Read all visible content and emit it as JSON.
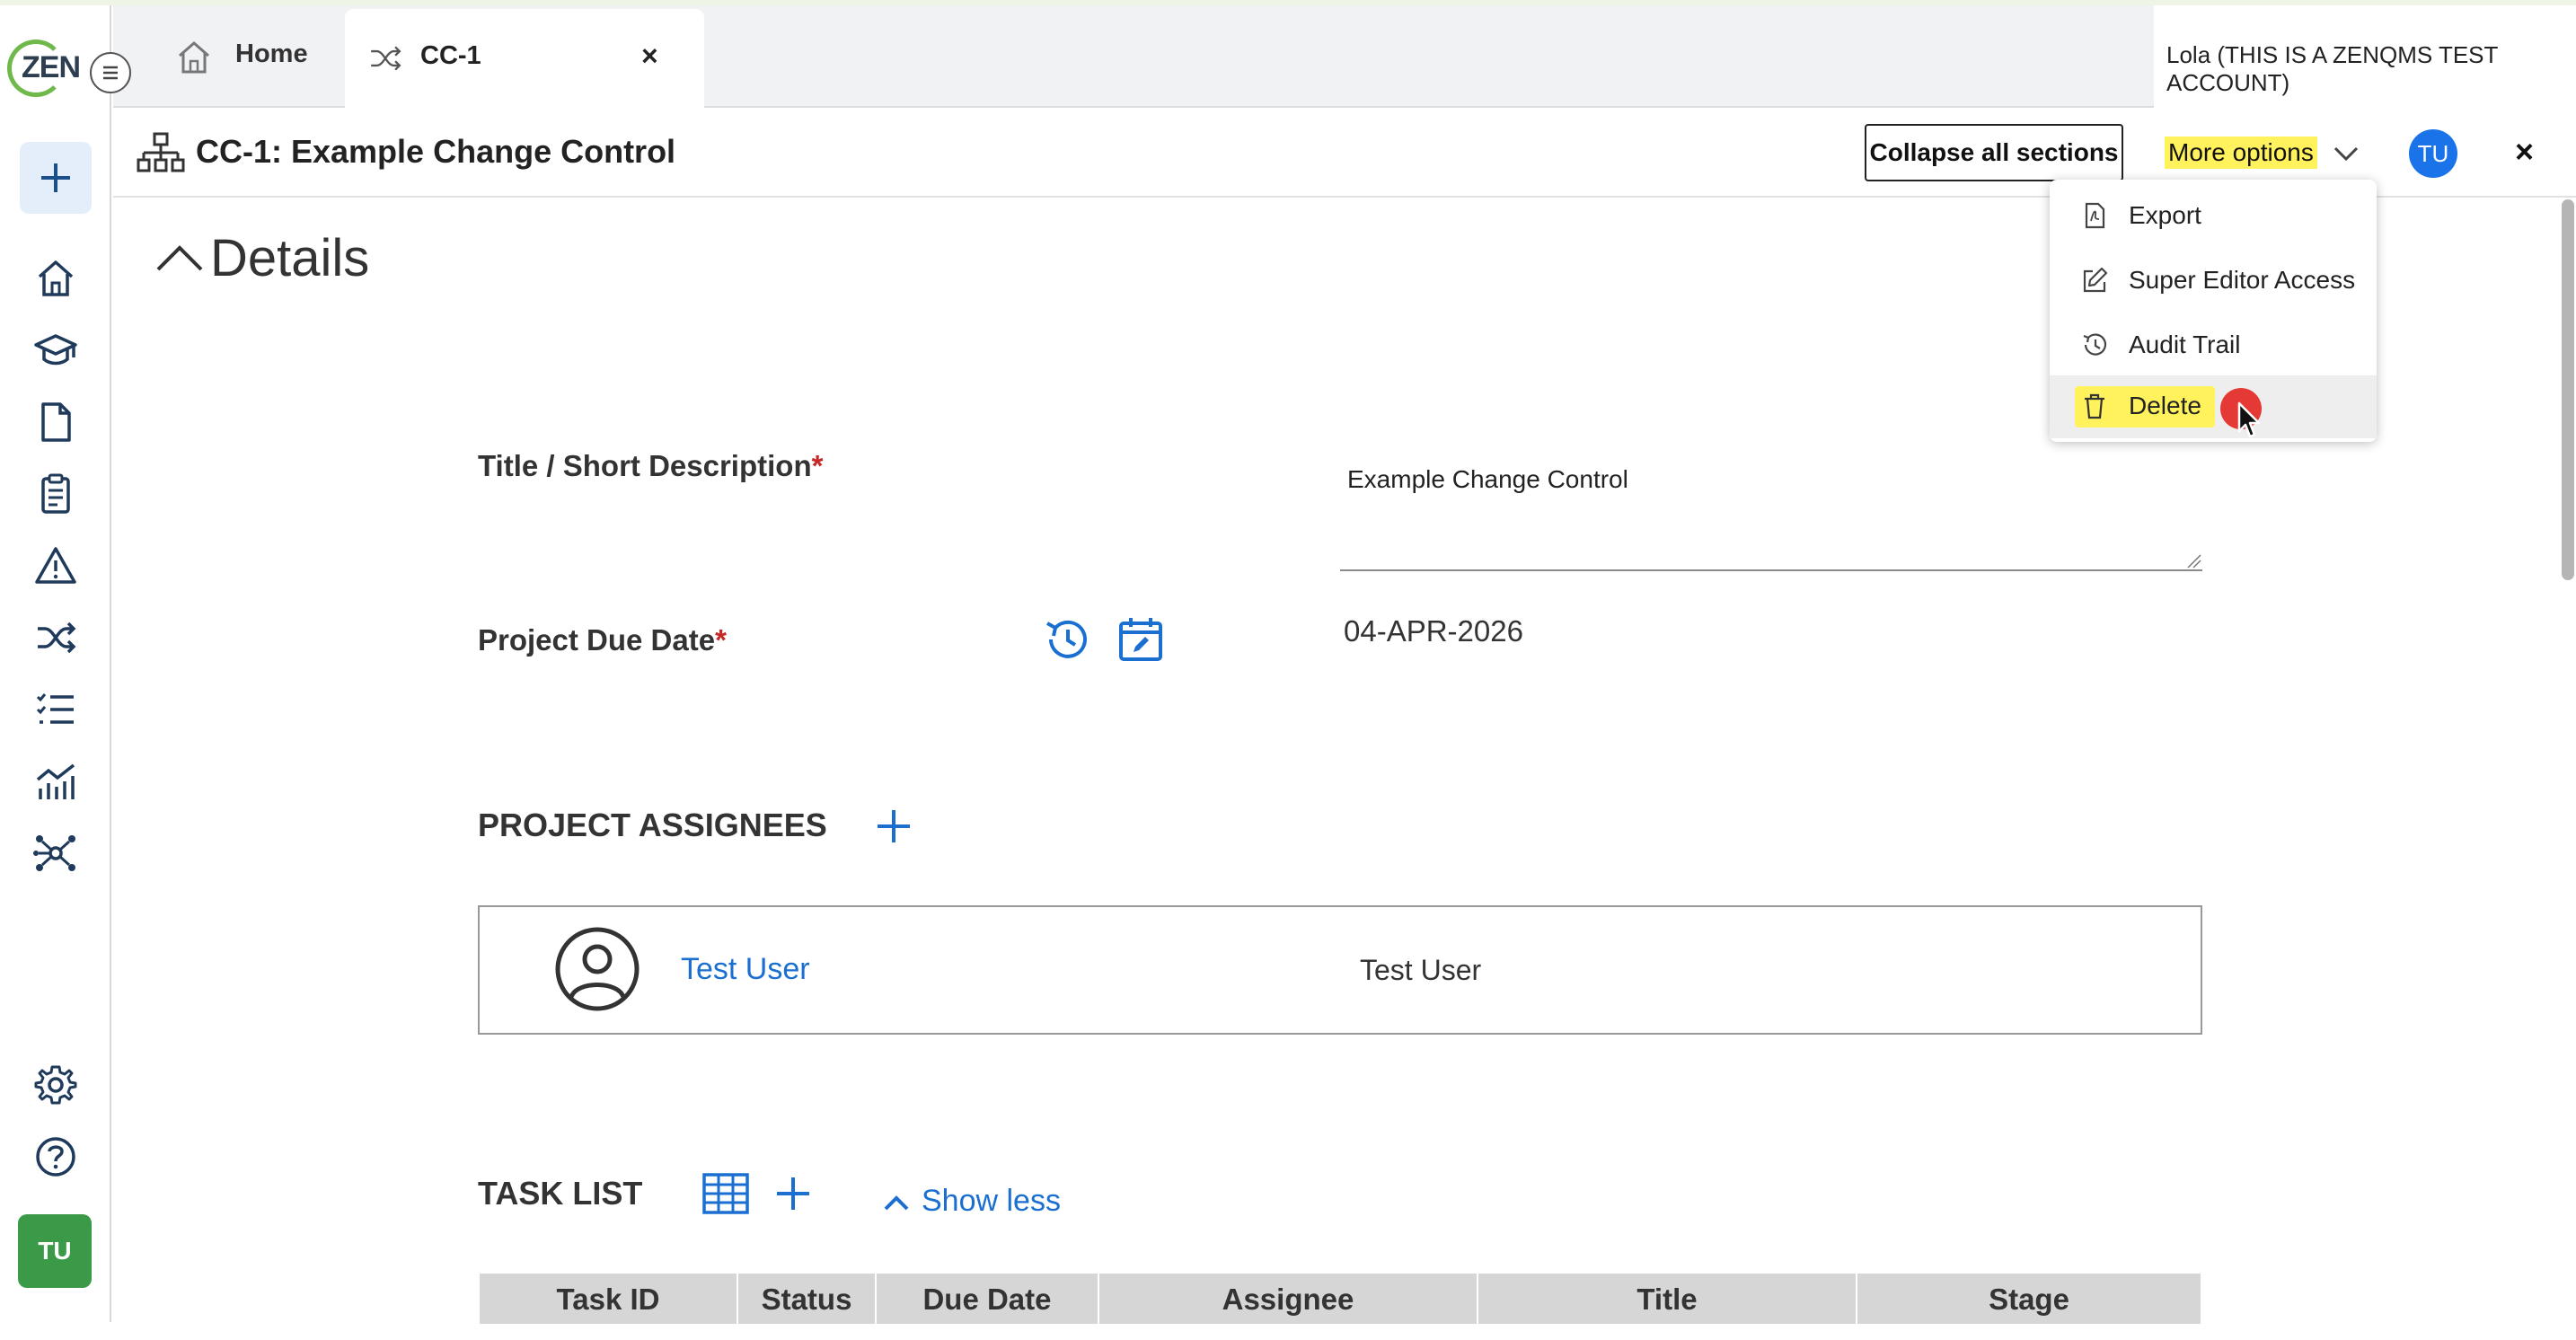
{
  "app": {
    "logo_text": "ZEN",
    "account_label": "Lola (THIS IS A ZENQMS TEST ACCOUNT)",
    "user_initials": "TU"
  },
  "colors": {
    "brand_green": "#6fb84a",
    "accent_blue": "#1a73e8",
    "highlight_yellow": "#fff25c",
    "required_red": "#c62828",
    "avatar_green": "#3a9a48"
  },
  "sidebar": {
    "items": [
      {
        "icon": "home-icon"
      },
      {
        "icon": "graduation-cap-icon"
      },
      {
        "icon": "document-icon"
      },
      {
        "icon": "clipboard-icon"
      },
      {
        "icon": "warning-icon"
      },
      {
        "icon": "shuffle-icon"
      },
      {
        "icon": "checklist-icon"
      },
      {
        "icon": "analytics-icon"
      },
      {
        "icon": "network-icon"
      }
    ],
    "bottom_items": [
      {
        "icon": "settings-icon"
      },
      {
        "icon": "help-icon"
      }
    ]
  },
  "tabs": [
    {
      "label": "Home",
      "icon": "home-icon",
      "active": false
    },
    {
      "label": "CC-1",
      "icon": "shuffle-icon",
      "active": true,
      "close": "×"
    }
  ],
  "header": {
    "title": "CC-1: Example Change Control",
    "collapse_label": "Collapse all sections",
    "more_options_label": "More options",
    "close_label": "×"
  },
  "more_options_menu": {
    "items": [
      {
        "label": "Export",
        "icon": "pdf-icon"
      },
      {
        "label": "Super Editor Access",
        "icon": "edit-icon"
      },
      {
        "label": "Audit Trail",
        "icon": "history-icon"
      },
      {
        "label": "Delete",
        "icon": "trash-icon",
        "hovered": true
      }
    ]
  },
  "details": {
    "section_title": "Details",
    "title_label": "Title / Short Description",
    "title_value": "Example Change Control",
    "due_date_label": "Project Due Date",
    "due_date_value": "04-APR-2026",
    "required_mark": "*"
  },
  "assignees": {
    "heading": "PROJECT ASSIGNEES",
    "rows": [
      {
        "link_name": "Test User",
        "name": "Test User"
      }
    ]
  },
  "task_list": {
    "heading": "TASK LIST",
    "show_less_label": "Show less",
    "columns": [
      "Task ID",
      "Status",
      "Due Date",
      "Assignee",
      "Title",
      "Stage"
    ]
  }
}
